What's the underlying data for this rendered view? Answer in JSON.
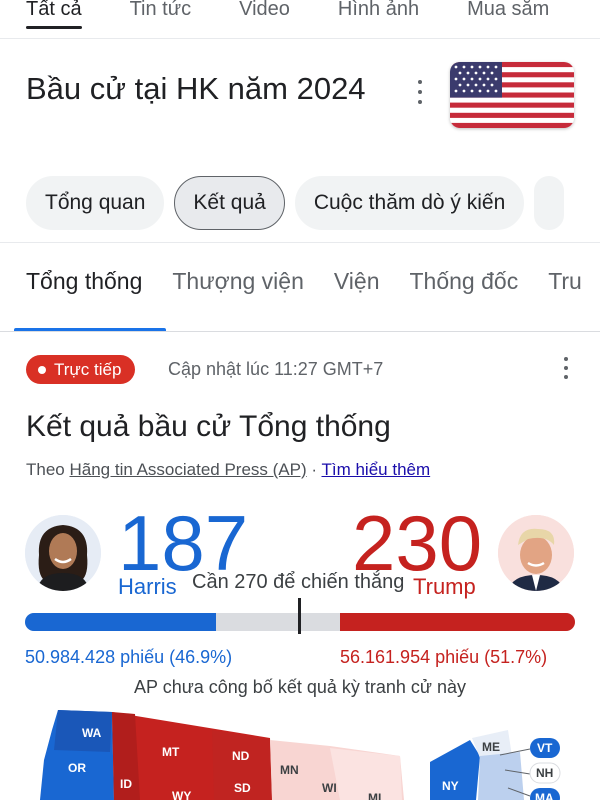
{
  "search_tabs": [
    {
      "label": "Tất cả"
    },
    {
      "label": "Tin tức"
    },
    {
      "label": "Video"
    },
    {
      "label": "Hình ảnh"
    },
    {
      "label": "Mua sắm"
    }
  ],
  "header": {
    "title": "Bầu cử tại HK năm 2024",
    "menu_icon": "more-vert-icon",
    "flag_icon": "us-flag-icon"
  },
  "chips": [
    {
      "label": "Tổng quan",
      "selected": false
    },
    {
      "label": "Kết quả",
      "selected": true
    },
    {
      "label": "Cuộc thăm dò ý kiến",
      "selected": false
    }
  ],
  "subtabs": [
    {
      "label": "Tổng thống",
      "active": true
    },
    {
      "label": "Thượng viện"
    },
    {
      "label": "Viện"
    },
    {
      "label": "Thống đốc"
    },
    {
      "label": "Tru"
    }
  ],
  "live": {
    "badge": "Trực tiếp",
    "updated": "Cập nhật lúc 11:27 GMT+7"
  },
  "results": {
    "title": "Kết quả bầu cử Tổng thống",
    "source_prefix": "Theo",
    "source_link": "Hãng tin Associated Press (AP)",
    "separator": "·",
    "learn_more": "Tìm hiểu thêm"
  },
  "candidates": {
    "left": {
      "name": "Harris",
      "electoral_votes": "187",
      "popular_votes": "50.984.428 phiếu (46.9%)",
      "color": "#1967d2"
    },
    "right": {
      "name": "Trump",
      "electoral_votes": "230",
      "popular_votes": "56.161.954 phiếu (51.7%)",
      "color": "#c5221f"
    },
    "needed_text": "Cần 270 để chiến thắng",
    "total_electoral": 538,
    "threshold": 270
  },
  "ap_note": "AP chưa công bố kết quả kỳ tranh cử này",
  "map": {
    "states": [
      {
        "abbr": "WA"
      },
      {
        "abbr": "OR"
      },
      {
        "abbr": "MT"
      },
      {
        "abbr": "ND"
      },
      {
        "abbr": "SD"
      },
      {
        "abbr": "ID"
      },
      {
        "abbr": "WY"
      },
      {
        "abbr": "MN"
      },
      {
        "abbr": "WI"
      },
      {
        "abbr": "MI"
      },
      {
        "abbr": "ME"
      },
      {
        "abbr": "NY"
      },
      {
        "abbr": "VT"
      },
      {
        "abbr": "NH"
      },
      {
        "abbr": "MA"
      }
    ]
  }
}
